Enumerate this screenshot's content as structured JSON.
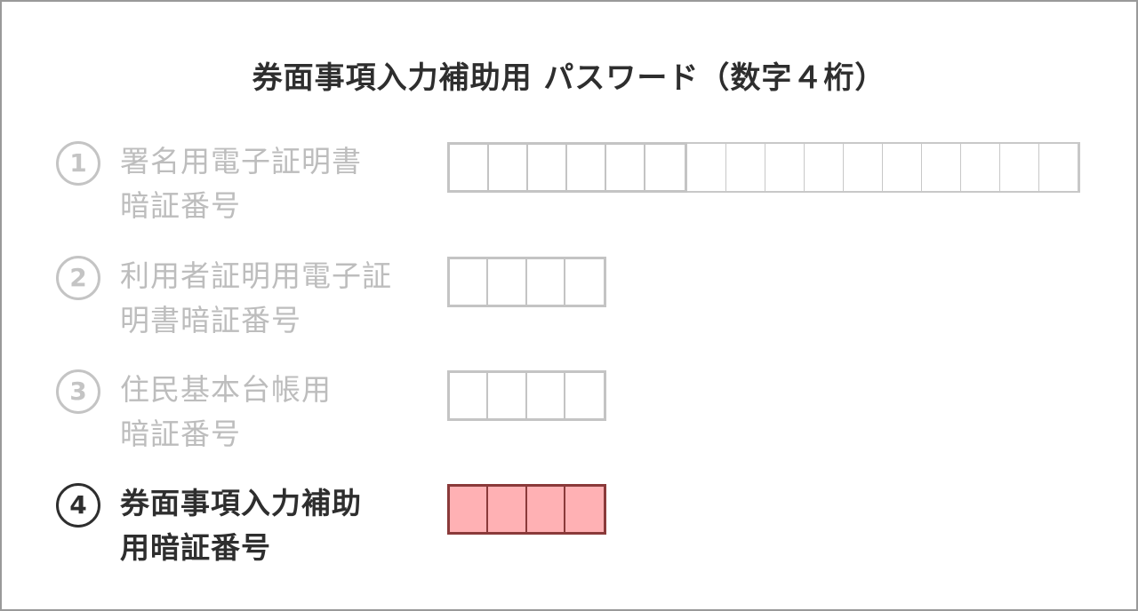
{
  "title": "券面事項入力補助用 パスワード（数字４桁）",
  "rows": [
    {
      "number": "1",
      "label_line1": "署名用電子証明書",
      "label_line2": "暗証番号",
      "digit_cells": 16,
      "required_cells": 6,
      "active": false
    },
    {
      "number": "2",
      "label_line1": "利用者証明用電子証",
      "label_line2": "明書暗証番号",
      "digit_cells": 4,
      "active": false
    },
    {
      "number": "3",
      "label_line1": "住民基本台帳用",
      "label_line2": "暗証番号",
      "digit_cells": 4,
      "active": false
    },
    {
      "number": "4",
      "label_line1": "券面事項入力補助",
      "label_line2": "用暗証番号",
      "digit_cells": 4,
      "active": true
    }
  ],
  "colors": {
    "active_text": "#2e2e2e",
    "inactive_text": "#bdbdbd",
    "active_cell_fill": "#ffb1b4",
    "active_cell_border": "#8a3a3a"
  }
}
